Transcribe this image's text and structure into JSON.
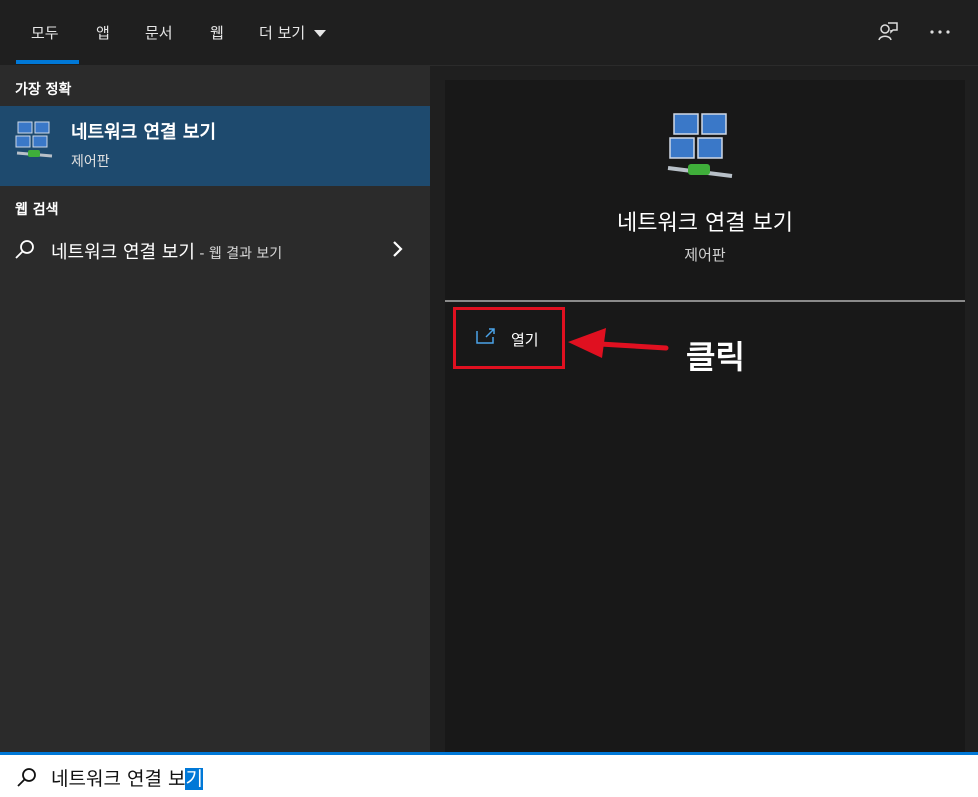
{
  "tabs": [
    "모두",
    "앱",
    "문서",
    "웹",
    "더 보기"
  ],
  "toolbar": {
    "feedback_icon": "feedback-icon",
    "more_icon": "ellipsis-icon"
  },
  "best_match": {
    "heading": "가장 정확",
    "title": "네트워크 연결 보기",
    "subtitle": "제어판"
  },
  "web_search": {
    "heading": "웹 검색",
    "query": "네트워크 연결 보기",
    "suffix": " - 웹 결과 보기"
  },
  "detail": {
    "title": "네트워크 연결 보기",
    "subtitle": "제어판",
    "open_label": "열기",
    "annotation": "클릭"
  },
  "search": {
    "text_before": "네트워크 연결 보",
    "text_selected": "기"
  },
  "colors": {
    "accent": "#0078d7",
    "selected_bg": "#1e4a6e",
    "highlight_red": "#e01020"
  }
}
